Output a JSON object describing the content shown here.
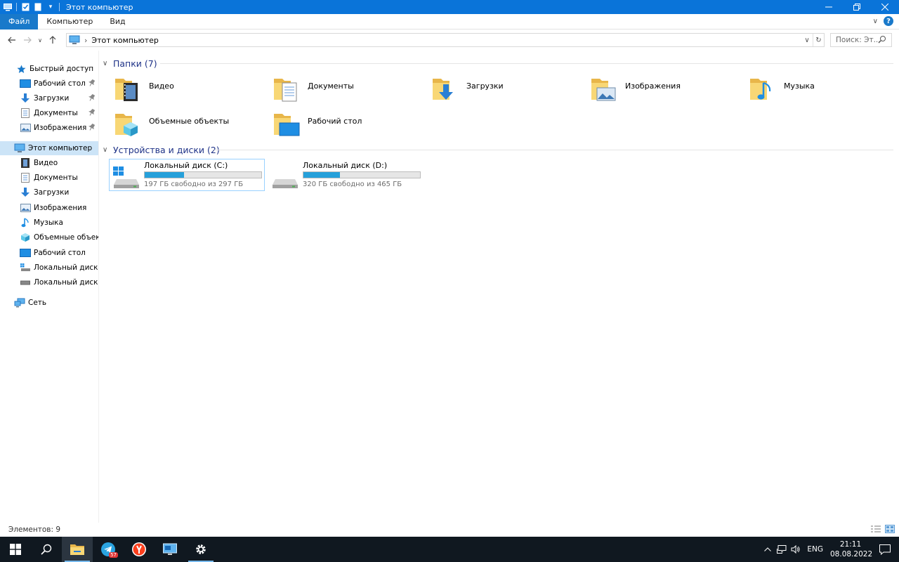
{
  "window": {
    "title": "Этот компьютер",
    "accent": "#0a74d9"
  },
  "ribbon": {
    "tabs": [
      {
        "label": "Файл"
      },
      {
        "label": "Компьютер"
      },
      {
        "label": "Вид"
      }
    ],
    "help_label": "?"
  },
  "address": {
    "path": "Этот компьютер",
    "separator": "›"
  },
  "search": {
    "placeholder": "Поиск: Эт..."
  },
  "sidebar": {
    "quick_access": "Быстрый доступ",
    "quick_items": [
      {
        "label": "Рабочий стол",
        "icon": "desktop-icon"
      },
      {
        "label": "Загрузки",
        "icon": "download-icon"
      },
      {
        "label": "Документы",
        "icon": "documents-icon"
      },
      {
        "label": "Изображения",
        "icon": "images-icon"
      }
    ],
    "this_pc": "Этот компьютер",
    "pc_items": [
      {
        "label": "Видео",
        "icon": "video-icon"
      },
      {
        "label": "Документы",
        "icon": "documents-icon"
      },
      {
        "label": "Загрузки",
        "icon": "download-icon"
      },
      {
        "label": "Изображения",
        "icon": "images-icon"
      },
      {
        "label": "Музыка",
        "icon": "music-icon"
      },
      {
        "label": "Объемные объекты",
        "icon": "3d-objects-icon"
      },
      {
        "label": "Рабочий стол",
        "icon": "desktop-icon"
      },
      {
        "label": "Локальный диск (C:)",
        "icon": "drive-c-icon"
      },
      {
        "label": "Локальный диск (D:)",
        "icon": "drive-d-icon"
      }
    ],
    "network": "Сеть"
  },
  "folders_group": {
    "title": "Папки (7)",
    "items": [
      {
        "label": "Видео",
        "icon": "video-folder-icon"
      },
      {
        "label": "Документы",
        "icon": "documents-folder-icon"
      },
      {
        "label": "Загрузки",
        "icon": "downloads-folder-icon"
      },
      {
        "label": "Изображения",
        "icon": "images-folder-icon"
      },
      {
        "label": "Музыка",
        "icon": "music-folder-icon"
      },
      {
        "label": "Объемные объекты",
        "icon": "3d-objects-folder-icon"
      },
      {
        "label": "Рабочий стол",
        "icon": "desktop-folder-icon"
      }
    ]
  },
  "drives_group": {
    "title": "Устройства и диски (2)",
    "items": [
      {
        "label": "Локальный диск (C:)",
        "free": "197 ГБ свободно из 297 ГБ",
        "used_fraction": 0.337
      },
      {
        "label": "Локальный диск (D:)",
        "free": "320 ГБ свободно из 465 ГБ",
        "used_fraction": 0.312
      }
    ],
    "bar_color": "#26a0da"
  },
  "status": {
    "items_count": "Элементов: 9"
  },
  "taskbar": {
    "apps": [
      {
        "name": "file-explorer-icon"
      },
      {
        "name": "telegram-icon",
        "badge": "57"
      },
      {
        "name": "yandex-browser-icon"
      },
      {
        "name": "remote-desktop-icon"
      },
      {
        "name": "settings-icon"
      }
    ],
    "lang": "ENG",
    "time": "21:11",
    "date": "08.08.2022"
  }
}
